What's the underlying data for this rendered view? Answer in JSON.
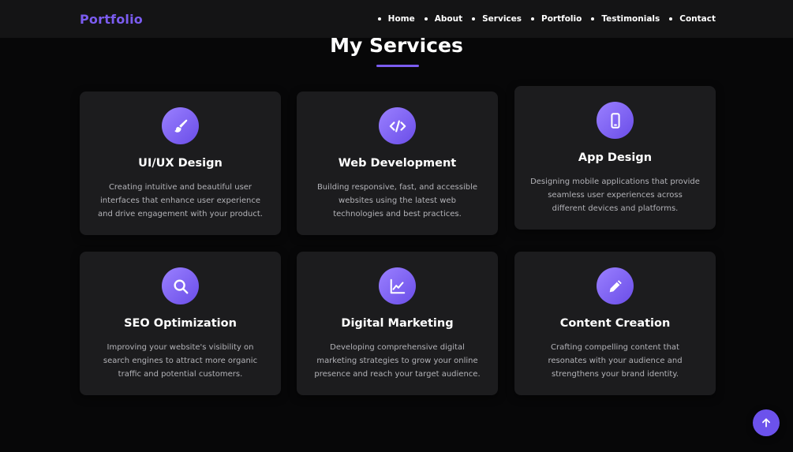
{
  "nav": {
    "brand": "Portfolio",
    "links": [
      "Home",
      "About",
      "Services",
      "Portfolio",
      "Testimonials",
      "Contact"
    ]
  },
  "section": {
    "title": "My Services"
  },
  "services": [
    {
      "icon": "paintbrush-icon",
      "title": "UI/UX Design",
      "desc": "Creating intuitive and beautiful user interfaces that enhance user experience and drive engagement with your product."
    },
    {
      "icon": "code-icon",
      "title": "Web Development",
      "desc": "Building responsive, fast, and accessible websites using the latest web technologies and best practices."
    },
    {
      "icon": "mobile-phone-icon",
      "title": "App Design",
      "desc": "Designing mobile applications that provide seamless user experiences across different devices and platforms."
    },
    {
      "icon": "search-icon",
      "title": "SEO Optimization",
      "desc": "Improving your website's visibility on search engines to attract more organic traffic and potential customers."
    },
    {
      "icon": "chart-line-icon",
      "title": "Digital Marketing",
      "desc": "Developing comprehensive digital marketing strategies to grow your online presence and reach your target audience."
    },
    {
      "icon": "pencil-icon",
      "title": "Content Creation",
      "desc": "Crafting compelling content that resonates with your audience and strengthens your brand identity."
    }
  ],
  "colors": {
    "accent": "#7b5cf0",
    "background": "#070708",
    "card": "#1c1c1e",
    "text_muted": "#b3b3b8"
  },
  "scroll_top_icon": "arrow-up-icon"
}
